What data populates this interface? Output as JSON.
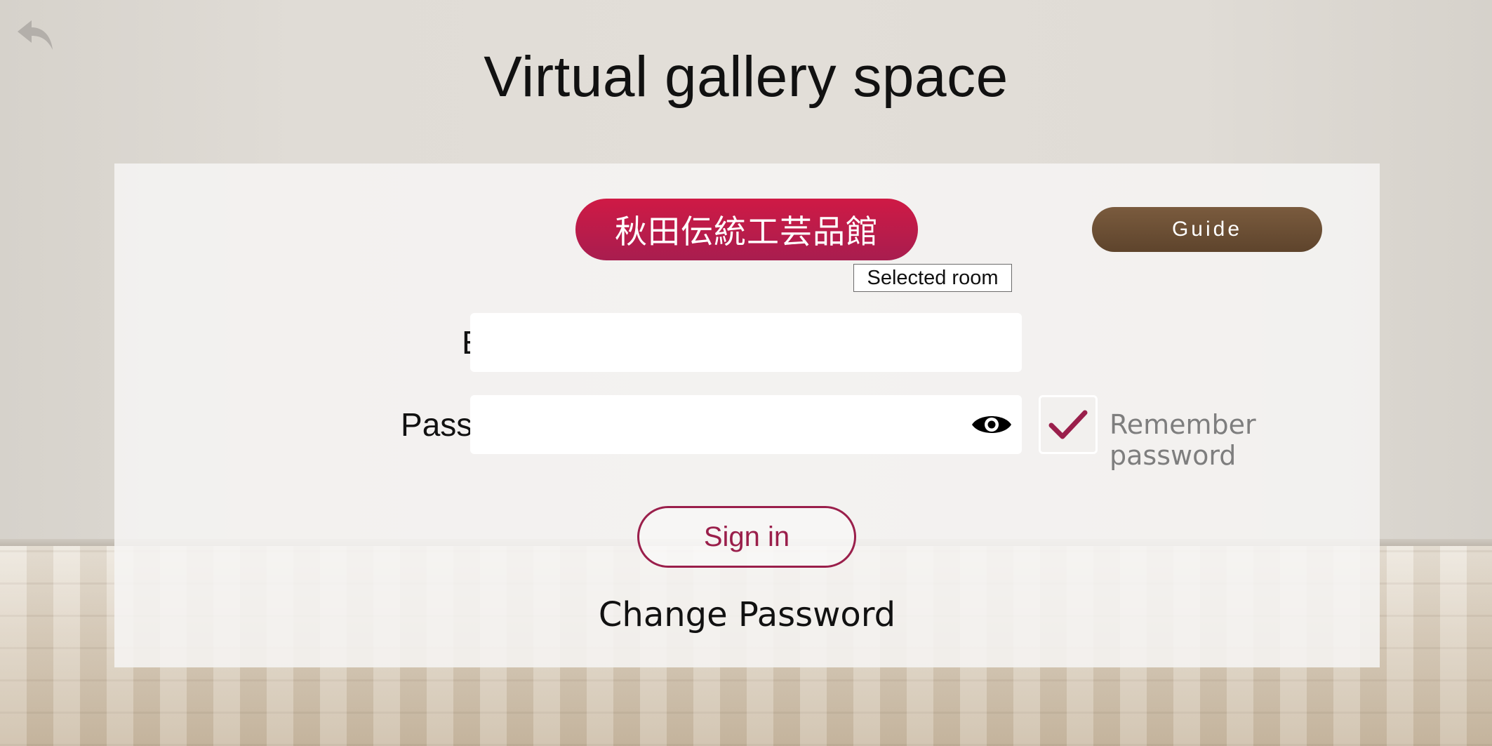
{
  "app": {
    "title": "Virtual gallery space",
    "back_icon": "reply-arrow-icon"
  },
  "panel": {
    "room_button_label": "秋田伝統工芸品館",
    "selected_room_tag": "Selected room",
    "guide_label": "Guide",
    "email": {
      "label": "Email",
      "value": "",
      "placeholder": ""
    },
    "password": {
      "label": "Password",
      "value": "",
      "placeholder": "",
      "toggle_icon": "eye-icon"
    },
    "remember": {
      "label": "Remember password",
      "checked": true,
      "icon": "checkmark-icon"
    },
    "signin_label": "Sign in",
    "change_password_label": "Change Password"
  },
  "colors": {
    "accent": "#9a1f4b",
    "room_button_top": "#cf1a45",
    "room_button_bottom": "#a81d4f",
    "guide_button": "#6b4e34",
    "remember_text": "#7e7e7e"
  }
}
